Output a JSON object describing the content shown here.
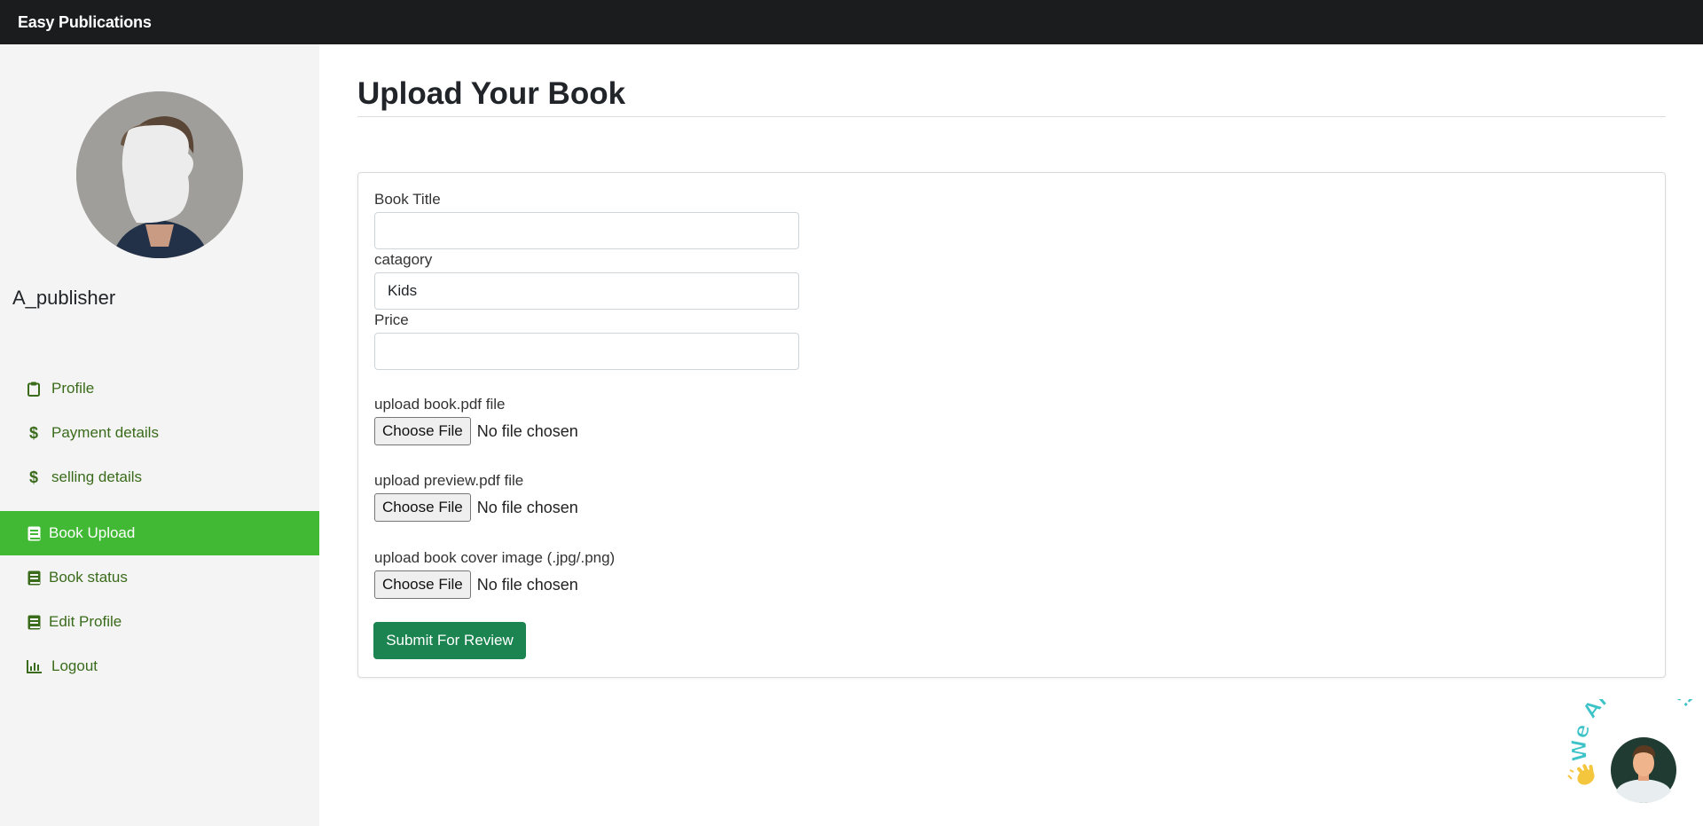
{
  "header": {
    "brand": "Easy Publications"
  },
  "sidebar": {
    "username": "A_publisher",
    "items": [
      {
        "label": "Profile",
        "icon": "clipboard-icon",
        "active": false
      },
      {
        "label": "Payment details",
        "icon": "dollar-icon",
        "active": false
      },
      {
        "label": "selling details",
        "icon": "dollar-icon",
        "active": false
      },
      {
        "label": "Book Upload",
        "icon": "book-icon",
        "active": true
      },
      {
        "label": "Book status",
        "icon": "book-icon",
        "active": false
      },
      {
        "label": "Edit Profile",
        "icon": "book-icon",
        "active": false
      },
      {
        "label": "Logout",
        "icon": "chart-icon",
        "active": false
      }
    ]
  },
  "main": {
    "title": "Upload Your Book",
    "form": {
      "book_title_label": "Book Title",
      "book_title_value": "",
      "category_label": "catagory",
      "category_value": "Kids",
      "price_label": "Price",
      "price_value": "",
      "book_pdf_label": "upload book.pdf file",
      "preview_pdf_label": "upload preview.pdf file",
      "cover_label": "upload book cover image (.jpg/.png)",
      "choose_file_label": "Choose File",
      "no_file_text": "No file chosen",
      "submit_label": "Submit For Review"
    }
  },
  "chat_widget": {
    "text": "We Are Here!",
    "icon": "waving-hand-icon"
  },
  "colors": {
    "topbar": "#1b1c1e",
    "sidebar_bg": "#f4f4f4",
    "nav_text": "#3a6b1a",
    "active_nav": "#42b935",
    "submit": "#1c8450",
    "chat_text": "#3cc3c8",
    "chat_avatar_bg": "#1f3b32"
  }
}
